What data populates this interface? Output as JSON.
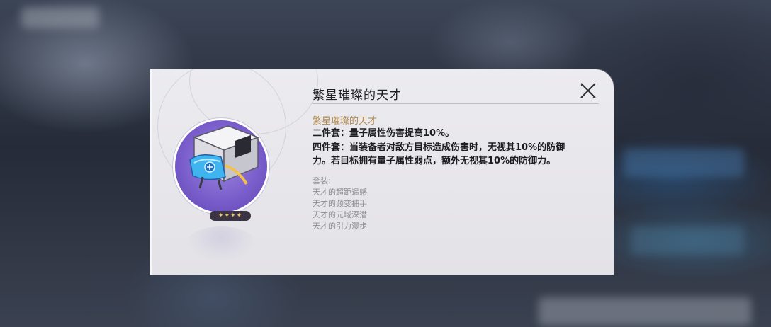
{
  "dialog": {
    "title": "繁星璀璨的天才",
    "close_icon": "close-icon",
    "relic": {
      "icon": "planar-ornament-icon",
      "rarity_stars": "✦✦✦✦",
      "rarity_level": 4,
      "circle_color": "#7a5fcc"
    },
    "set_name": "繁星璀璨的天才",
    "two_piece": "二件套：量子属性伤害提高10%。",
    "four_piece_line1": "四件套：当装备者对敌方目标造成伤害时，无视其10%的防御",
    "four_piece_line2": "力。若目标拥有量子属性弱点，额外无视其10%的防御力。",
    "pieces_label": "套装:",
    "pieces": [
      "天才的超距遥感",
      "天才的频变捕手",
      "天才的元域深潜",
      "天才的引力漫步"
    ],
    "accent_color": "#b08a4e"
  }
}
